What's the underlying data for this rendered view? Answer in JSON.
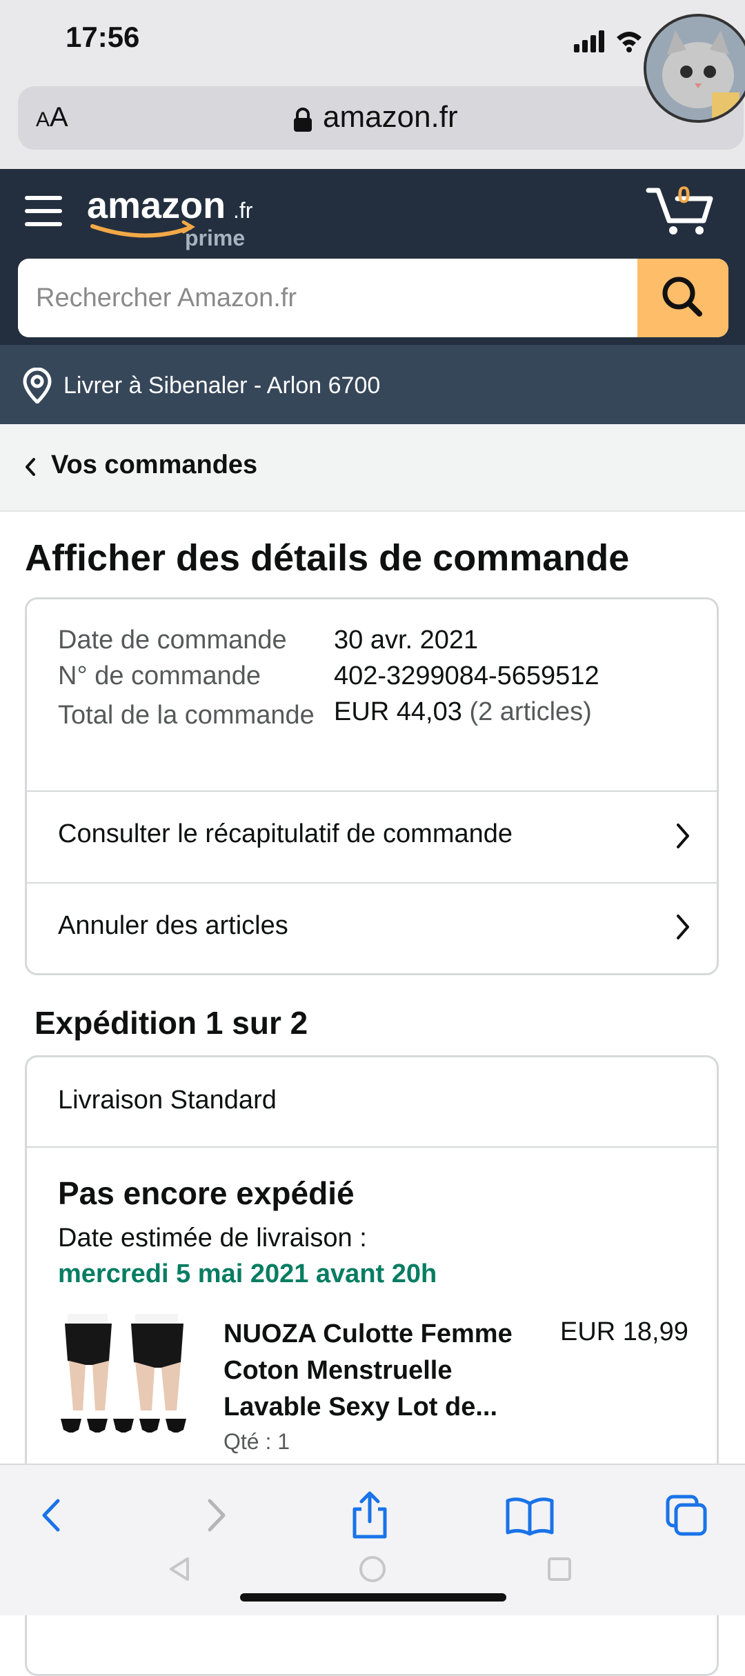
{
  "status_bar": {
    "time": "17:56"
  },
  "browser": {
    "text_size_label": "AA",
    "domain": "amazon.fr"
  },
  "header": {
    "logo_text": "amazon",
    "logo_tld": ".fr",
    "logo_prime": "prime",
    "cart_count": "0",
    "search_placeholder": "Rechercher Amazon.fr",
    "accent_color": "#febd69"
  },
  "delivery": {
    "text": "Livrer à Sibenaler - Arlon 6700"
  },
  "breadcrumb": {
    "label": "Vos commandes"
  },
  "page": {
    "title": "Afficher des détails de commande"
  },
  "order": {
    "date_label": "Date de commande",
    "date_value": "30 avr. 2021",
    "number_label": "N° de commande",
    "number_value": "402-3299084-5659512",
    "total_label": "Total de la commande",
    "total_value": "EUR 44,03",
    "total_items": "(2 articles)",
    "summary_link": "Consulter le récapitulatif de commande",
    "cancel_link": "Annuler des articles"
  },
  "shipment": {
    "heading": "Expédition 1 sur 2",
    "method": "Livraison Standard",
    "status": "Pas encore expédié",
    "eta_label": "Date estimée de livraison :",
    "eta_date": "mercredi 5 mai 2021 avant 20h",
    "eta_color": "#067d62",
    "product": {
      "title": "NUOZA Culotte Femme Coton Menstruelle Lavable Sexy Lot de...",
      "price": "EUR 18,99",
      "qty": "Qté : 1"
    }
  },
  "toolbar": {
    "icons": [
      "back-icon",
      "forward-icon",
      "share-icon",
      "bookmarks-icon",
      "tabs-icon"
    ],
    "tint_color": "#1a73e8"
  }
}
